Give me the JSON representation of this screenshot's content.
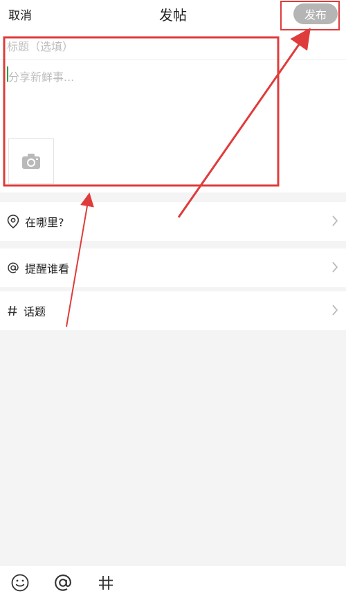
{
  "header": {
    "cancel_label": "取消",
    "title": "发帖",
    "publish_label": "发布"
  },
  "editor": {
    "title_placeholder": "标题（选填）",
    "content_placeholder": "分享新鲜事..."
  },
  "rows": {
    "where_label": "在哪里?",
    "mention_label": "提醒谁看",
    "topic_label": "话题"
  },
  "toolbar": {
    "emoji_icon": "emoji-icon",
    "mention_icon": "at-icon",
    "hashtag_icon": "hashtag-icon"
  },
  "colors": {
    "publish_button_bg": "#b5b5b5",
    "cursor": "#2aa24a",
    "annotation_red": "#e03b3b",
    "page_bg": "#f4f4f4"
  }
}
